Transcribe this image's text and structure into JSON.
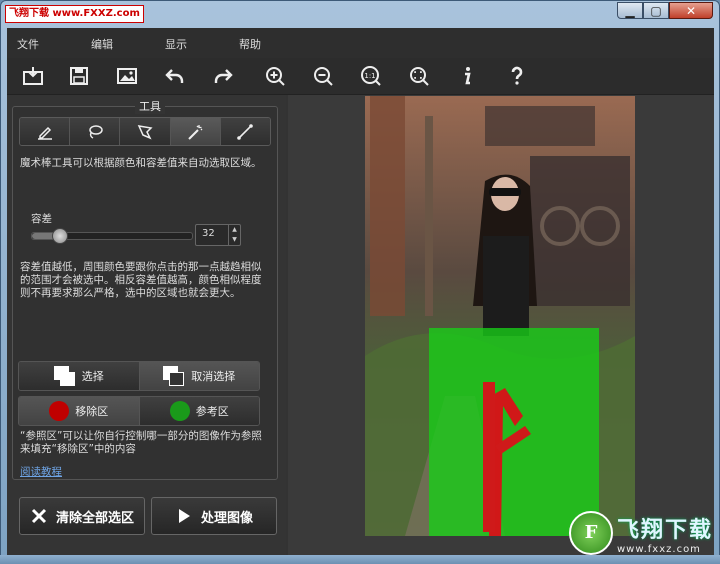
{
  "window": {
    "logo_text": "飞翔下载 www.FXXZ.com",
    "minimize_label": "▁",
    "maximize_label": "▢",
    "close_label": "✕"
  },
  "menu": [
    "文件",
    "编辑",
    "显示",
    "帮助"
  ],
  "toolbar_icons": [
    "open-icon",
    "save-icon",
    "image-icon",
    "undo-icon",
    "redo-icon",
    "zoom-in-icon",
    "zoom-out-icon",
    "actual-size-icon",
    "fit-icon",
    "info-icon",
    "help-icon"
  ],
  "toolbar_one_to_one": "1:1",
  "toolbox": {
    "title": "工具",
    "tools": [
      "marker-tool",
      "lasso-tool",
      "polygon-lasso-tool",
      "magic-wand-tool",
      "line-tool"
    ],
    "active_tool_index": 3,
    "description": "魔术棒工具可以根据颜色和容差值来自动选取区域。",
    "tolerance_label": "容差",
    "tolerance_value": "32",
    "tolerance_fraction": 0.17,
    "tolerance_help": "容差值越低，周围颜色要跟你点击的那一点越趋相似的范围才会被选中。相反容差值越高，颜色相似程度则不再要求那么严格，选中的区域也就会更大。",
    "select_label": "选择",
    "deselect_label": "取消选择",
    "remove_area_label": "移除区",
    "reference_area_label": "参考区",
    "remove_color": "#c00000",
    "reference_color": "#1a9a1a",
    "reference_note": "“参照区”可以让你自行控制哪一部分的图像作为参照来填充“移除区”中的内容",
    "tutorial_link": "阅读教程"
  },
  "actions": {
    "clear_all_label": "清除全部选区",
    "process_label": "处理图像"
  },
  "watermark": {
    "logo_letter": "F",
    "brand": "飞翔下载",
    "url": "www.fxxz.com"
  }
}
